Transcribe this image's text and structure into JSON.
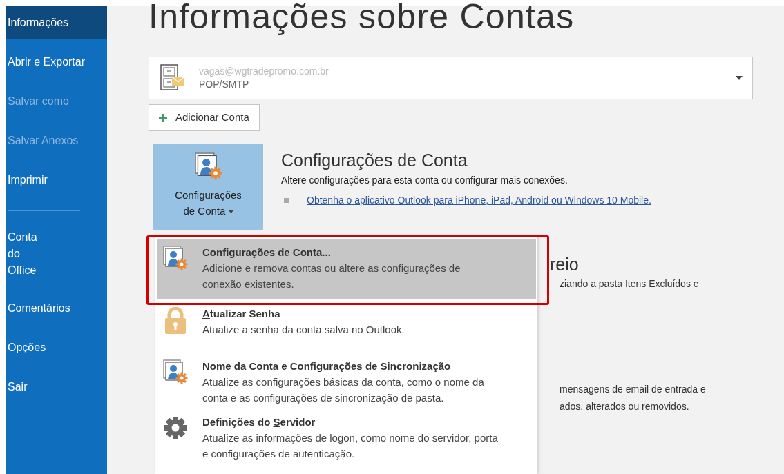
{
  "sidebar": {
    "items": [
      {
        "label": "Informações",
        "selected": true,
        "disabled": false
      },
      {
        "label": "Abrir e Exportar",
        "selected": false,
        "disabled": false
      },
      {
        "label": "Salvar como",
        "selected": false,
        "disabled": true
      },
      {
        "label": "Salvar Anexos",
        "selected": false,
        "disabled": true
      },
      {
        "label": "Imprimir",
        "selected": false,
        "disabled": false,
        "divider_after": true
      },
      {
        "label": "Conta do Office",
        "selected": false,
        "disabled": false
      },
      {
        "label": "Comentários",
        "selected": false,
        "disabled": false
      },
      {
        "label": "Opções",
        "selected": false,
        "disabled": false
      },
      {
        "label": "Sair",
        "selected": false,
        "disabled": false
      }
    ]
  },
  "page_title": "Informações sobre Contas",
  "account": {
    "email": "vagas@wgtradepromo.com.br",
    "type": "POP/SMTP"
  },
  "add_account_button": "Adicionar Conta",
  "account_settings": {
    "button_label": "Configurações de Conta",
    "heading": "Configurações de Conta",
    "description": "Altere configurações para esta conta ou configurar mais conexões.",
    "link": "Obtenha o aplicativo Outlook para iPhone, iPad, Android ou Windows 10 Mobile."
  },
  "background_fragments": [
    {
      "kind": "heading",
      "text": "reio"
    },
    {
      "kind": "line",
      "text": "ziando a pasta Itens Excluídos e"
    },
    {
      "kind": "gap"
    },
    {
      "kind": "line",
      "text": "mensagens de email de entrada e"
    },
    {
      "kind": "line",
      "text": "ados, alterados ou removidos."
    }
  ],
  "menu": {
    "items": [
      {
        "kind": "user-gear",
        "title": {
          "before": "Configurações de Con",
          "access_key": "t",
          "after": "a..."
        },
        "description": "Adicione e remova contas ou altere as configurações de conexão existentes.",
        "selected": true
      },
      {
        "kind": "lock",
        "title": {
          "access_key": "A",
          "after": "tualizar Senha"
        },
        "description": "Atualize a senha da conta salva no Outlook.",
        "selected": false
      },
      {
        "kind": "user-gear",
        "title": {
          "access_key": "N",
          "after": "ome da Conta e Configurações de Sincronização"
        },
        "description": "Atualize as configurações básicas da conta, como o nome da conta e as configurações de sincronização de pasta.",
        "selected": false
      },
      {
        "kind": "gear",
        "title": {
          "before": "Definições do ",
          "access_key": "S",
          "after": "ervidor"
        },
        "description": "Atualize as informações de logon, como nome do servidor, porta e configurações de autenticação.",
        "selected": false
      }
    ]
  }
}
